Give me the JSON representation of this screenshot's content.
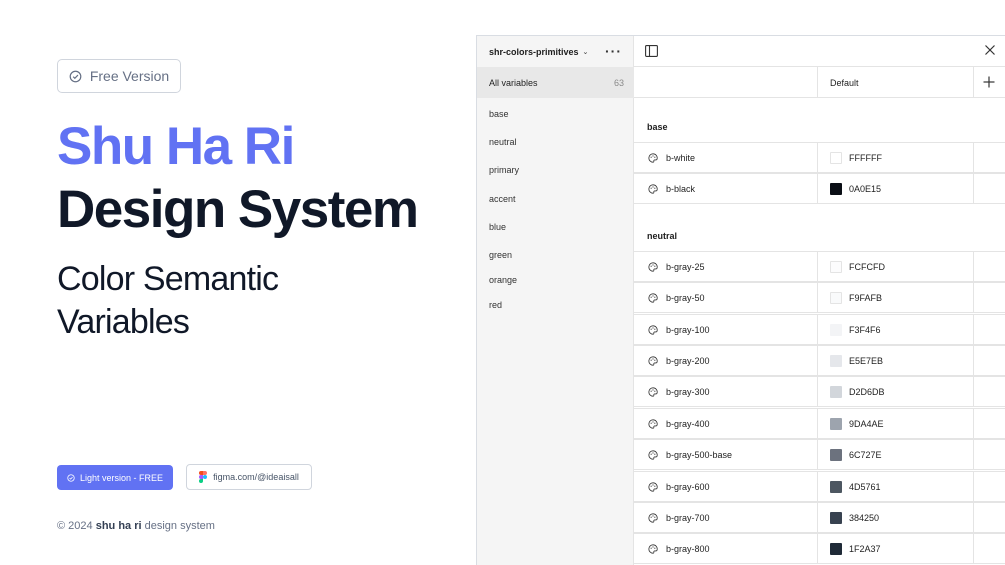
{
  "hero": {
    "badge_label": "Free Version",
    "title_line1": "Shu Ha Ri",
    "title_line2": "Design System",
    "subtitle": "Color Semantic Variables",
    "primary_button": "Light version - FREE",
    "secondary_button": "figma.com/@ideaisall",
    "footer_prefix": "© 2024 ",
    "footer_bold": "shu ha ri",
    "footer_suffix": " design system",
    "accent_color": "#6172F3"
  },
  "panel": {
    "collection_name": "shr-colors-primitives",
    "all_variables_label": "All variables",
    "all_variables_count": "63",
    "groups": [
      "base",
      "neutral",
      "primary",
      "accent",
      "blue",
      "green",
      "orange",
      "red"
    ],
    "mode_header": "Default",
    "sections": [
      {
        "title": "base",
        "rows": [
          {
            "name": "b-white",
            "value": "FFFFFF",
            "color": "#FFFFFF"
          },
          {
            "name": "b-black",
            "value": "0A0E15",
            "color": "#0A0E15"
          }
        ]
      },
      {
        "title": "neutral",
        "rows": [
          {
            "name": "b-gray-25",
            "value": "FCFCFD",
            "color": "#FCFCFD"
          },
          {
            "name": "b-gray-50",
            "value": "F9FAFB",
            "color": "#F9FAFB"
          },
          {
            "name": "b-gray-100",
            "value": "F3F4F6",
            "color": "#F3F4F6"
          },
          {
            "name": "b-gray-200",
            "value": "E5E7EB",
            "color": "#E5E7EB"
          },
          {
            "name": "b-gray-300",
            "value": "D2D6DB",
            "color": "#D2D6DB"
          },
          {
            "name": "b-gray-400",
            "value": "9DA4AE",
            "color": "#9DA4AE"
          },
          {
            "name": "b-gray-500-base",
            "value": "6C727E",
            "color": "#6C727E"
          },
          {
            "name": "b-gray-600",
            "value": "4D5761",
            "color": "#4D5761"
          },
          {
            "name": "b-gray-700",
            "value": "384250",
            "color": "#384250"
          },
          {
            "name": "b-gray-800",
            "value": "1F2A37",
            "color": "#1F2A37"
          }
        ]
      }
    ]
  }
}
